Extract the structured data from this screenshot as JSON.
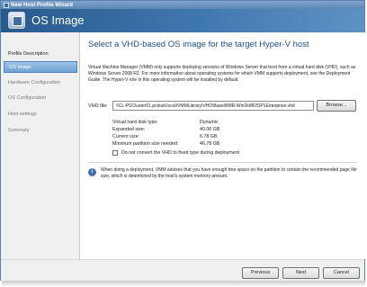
{
  "window": {
    "title": "New Host Profile Wizard"
  },
  "header": {
    "title": "OS Image",
    "icon": "wizard-icon"
  },
  "nav": {
    "items": [
      {
        "label": "Profile Description",
        "state": "normal"
      },
      {
        "label": "OS Image",
        "state": "selected"
      },
      {
        "label": "Hardware Configuration",
        "state": "dim"
      },
      {
        "label": "OS Configuration",
        "state": "dim"
      },
      {
        "label": "Host settings",
        "state": "dim"
      },
      {
        "label": "Summary",
        "state": "dim"
      }
    ]
  },
  "main": {
    "heading": "Select a VHD-based OS image for the target Hyper-V host",
    "intro": "Virtual Machine Manager (VMM) only supports deploying versions of Windows Server that boot from a virtual hard disk (VHD), such as Windows Server 2008 R2. For more information about operating systems for which VMM supports deployment, see the Deployment Guide. The Hyper-V role in this operating system will be installed by default.",
    "vhd_label": "VHD file:",
    "vhd_value": "\\\\CL-PSCluster01.pcloud.local\\VMMLibrary\\VHD\\Base\\BMR-Win2k8R2SP1Enterprise.vhd",
    "browse_label": "Browse...",
    "properties": [
      {
        "key": "Virtual hard disk type:",
        "value": "Dynamic"
      },
      {
        "key": "Expanded size:",
        "value": "40.00 GB"
      },
      {
        "key": "Current size:",
        "value": "6.78 GB"
      },
      {
        "key": "Minimum partition size needed:",
        "value": "46.78 GB"
      }
    ],
    "checkbox_label": "Do not convert the VHD to fixed type during deployment",
    "checkbox_checked": false,
    "note": "When doing a deployment, VMM advises that you have enough free space on the partition to contain the recommended page file size, which is determined by the host's system memory amount."
  },
  "footer": {
    "previous_label": "Previous",
    "next_label": "Next",
    "cancel_label": "Cancel"
  }
}
